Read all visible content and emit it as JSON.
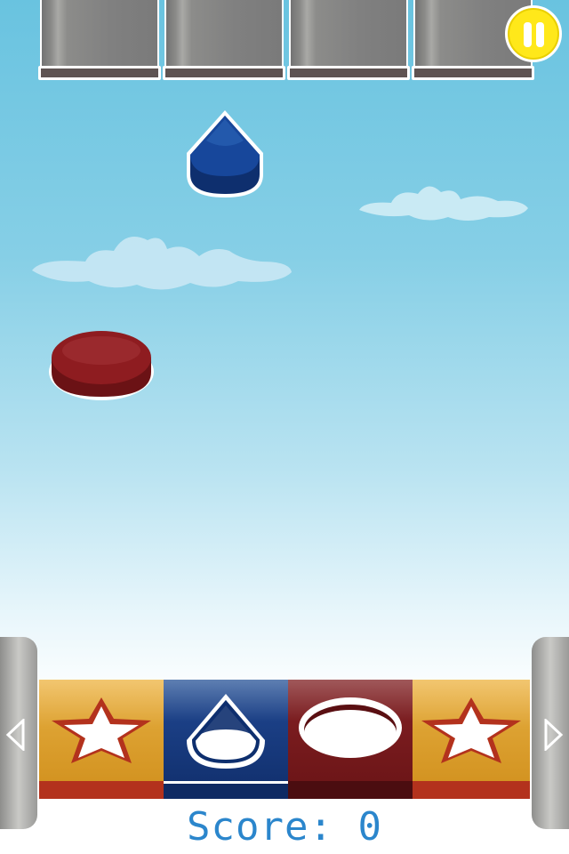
{
  "game": {
    "score_label": "Score: 0",
    "score": 0
  },
  "hud": {
    "pause_icon": "pause-icon",
    "left_icon": "triangle-left-icon",
    "right_icon": "triangle-right-icon"
  },
  "chutes": [
    "chute",
    "chute",
    "chute",
    "chute"
  ],
  "falling_shapes": [
    {
      "shape": "teardrop",
      "color": "#12397d"
    },
    {
      "shape": "circle",
      "color": "#8a1a1e"
    }
  ],
  "bins": [
    {
      "shape": "star",
      "color": "#d49022"
    },
    {
      "shape": "teardrop",
      "color": "#12397d"
    },
    {
      "shape": "circle",
      "color": "#6f1518"
    },
    {
      "shape": "star",
      "color": "#d49022"
    }
  ],
  "colors": {
    "pause_yellow": "#ffe81a",
    "score_blue": "#2b86cc",
    "star_outline": "#b3321d",
    "bin_stripe_orange": "#b3321d"
  }
}
